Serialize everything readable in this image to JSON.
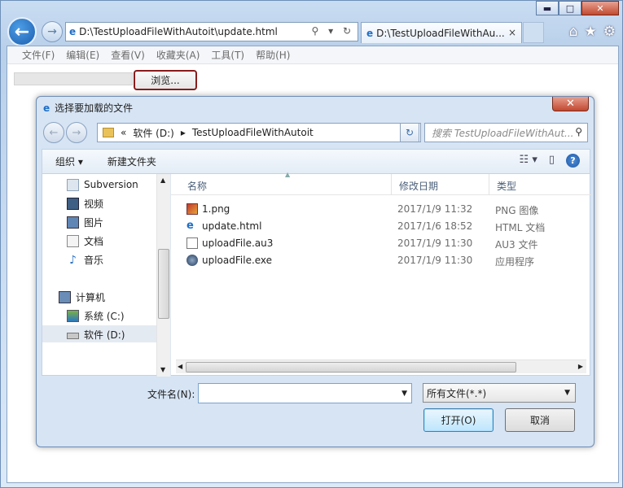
{
  "browser": {
    "address": "D:\\TestUploadFileWithAutoit\\update.html",
    "tab_title": "D:\\TestUploadFileWithAu...",
    "tab_close": "×",
    "window_buttons": {
      "minimize": "▬",
      "maximize": "□",
      "close": "✕"
    },
    "nav_back_glyph": "←",
    "nav_forward_glyph": "→",
    "address_tools": "⚲ ▾ ↻",
    "toolbar_icons": {
      "home": "⌂",
      "favorites": "★",
      "settings": "⚙"
    }
  },
  "menu": [
    "文件(F)",
    "编辑(E)",
    "查看(V)",
    "收藏夹(A)",
    "工具(T)",
    "帮助(H)"
  ],
  "page": {
    "browse_button": "浏览..."
  },
  "dialog": {
    "title": "选择要加载的文件",
    "close_glyph": "✕",
    "breadcrumb": [
      "«",
      "软件 (D:)",
      "▸",
      "TestUploadFileWithAutoit"
    ],
    "search_placeholder": "搜索 TestUploadFileWithAut...",
    "search_icon": "⚲",
    "toolbar": {
      "organize": "组织 ▾",
      "new_folder": "新建文件夹"
    },
    "nav_items": [
      "Subversion",
      "视频",
      "图片",
      "文档",
      "音乐",
      "计算机",
      "系统 (C:)",
      "软件 (D:)"
    ],
    "columns": [
      "名称",
      "修改日期",
      "类型"
    ],
    "files": [
      {
        "name": "1.png",
        "date": "2017/1/9 11:32",
        "type": "PNG 图像"
      },
      {
        "name": "update.html",
        "date": "2017/1/6 18:52",
        "type": "HTML 文档"
      },
      {
        "name": "uploadFile.au3",
        "date": "2017/1/9 11:30",
        "type": "AU3 文件"
      },
      {
        "name": "uploadFile.exe",
        "date": "2017/1/9 11:30",
        "type": "应用程序"
      }
    ],
    "filename_label": "文件名(N):",
    "filename_value": "",
    "filter": "所有文件(*.*)",
    "open_button": "打开(O)",
    "cancel_button": "取消"
  }
}
